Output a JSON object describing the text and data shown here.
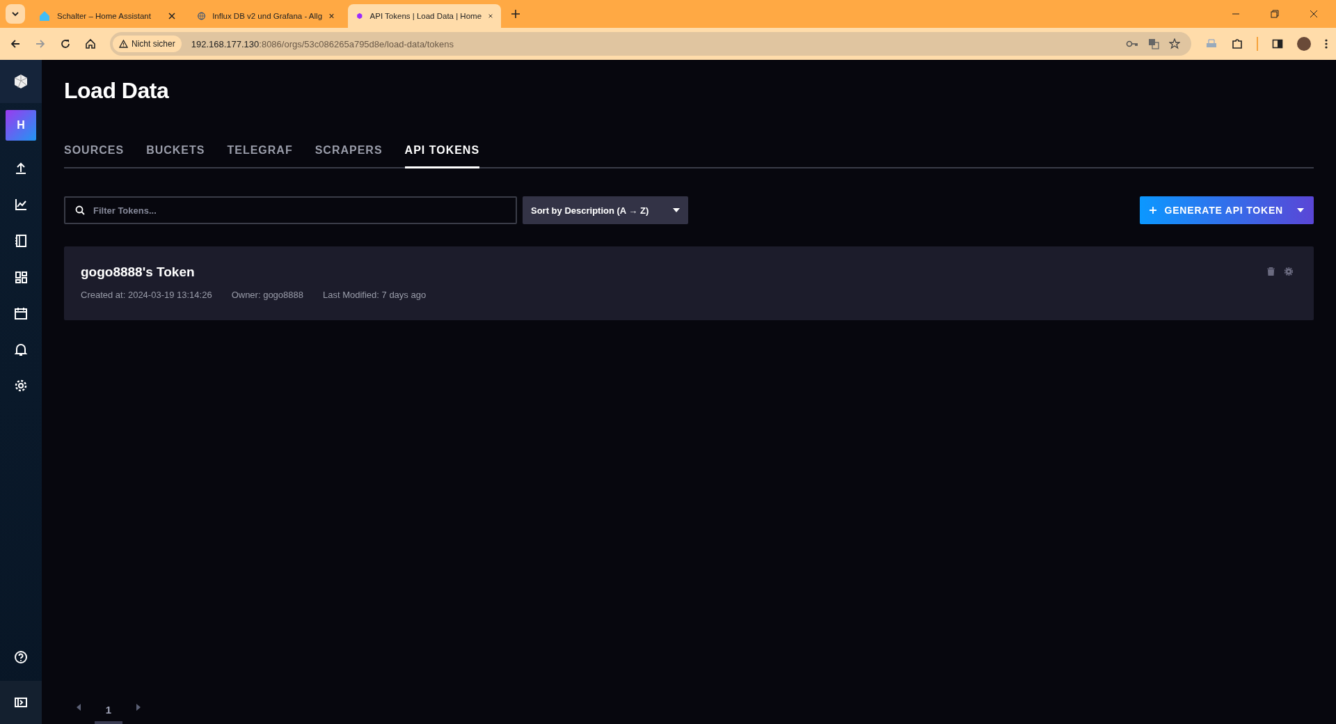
{
  "browser": {
    "tabs": [
      {
        "title": "Schalter – Home Assistant",
        "selected": false,
        "kind": "ha"
      },
      {
        "title": "Influx DB v2 und Grafana - Allg",
        "selected": false,
        "kind": "forum"
      },
      {
        "title": "API Tokens | Load Data | Home",
        "selected": true,
        "kind": "influx"
      }
    ],
    "security": "Nicht sicher",
    "url_host": "192.168.177.130",
    "url_rest": ":8086/orgs/53c086265a795d8e/load-data/tokens"
  },
  "sidebar": {
    "org_initial": "H"
  },
  "page": {
    "title": "Load Data",
    "tabs": [
      {
        "label": "SOURCES",
        "selected": false
      },
      {
        "label": "BUCKETS",
        "selected": false
      },
      {
        "label": "TELEGRAF",
        "selected": false
      },
      {
        "label": "SCRAPERS",
        "selected": false
      },
      {
        "label": "API TOKENS",
        "selected": true
      }
    ],
    "filter": {
      "placeholder": "Filter Tokens..."
    },
    "sort": {
      "label": "Sort by Description (A → Z)"
    },
    "generate_button": "GENERATE API TOKEN",
    "tokens": [
      {
        "name": "gogo8888's Token",
        "created": "Created at: 2024-03-19 13:14:26",
        "owner": "Owner: gogo8888",
        "modified": "Last Modified: 7 days ago"
      }
    ],
    "pagination": {
      "pages": [
        {
          "label": "1",
          "selected": true
        }
      ]
    }
  }
}
